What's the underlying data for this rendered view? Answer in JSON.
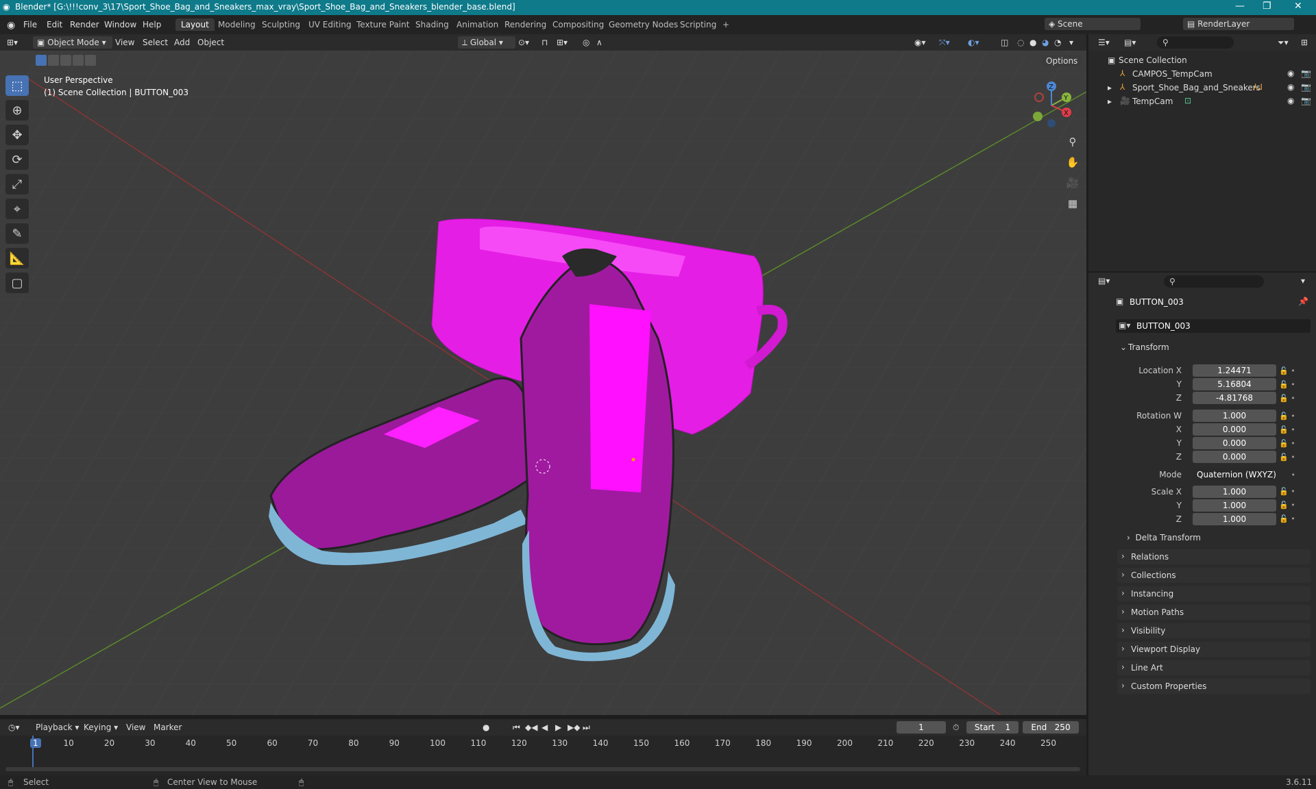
{
  "title_bar": {
    "title": "Blender* [G:\\!!!conv_3\\17\\Sport_Shoe_Bag_and_Sneakers_max_vray\\Sport_Shoe_Bag_and_Sneakers_blender_base.blend]",
    "minimize": "—",
    "maximize": "❐",
    "close": "✕"
  },
  "menu": [
    "File",
    "Edit",
    "Render",
    "Window",
    "Help"
  ],
  "workspaces": [
    "Layout",
    "Modeling",
    "Sculpting",
    "UV Editing",
    "Texture Paint",
    "Shading",
    "Animation",
    "Rendering",
    "Compositing",
    "Geometry Nodes",
    "Scripting",
    "+"
  ],
  "scene": "Scene",
  "render_layer": "RenderLayer",
  "viewport_header": {
    "mode": "Object Mode",
    "view": "View",
    "select": "Select",
    "add": "Add",
    "object": "Object",
    "orientation": "Global",
    "options": "Options"
  },
  "viewport_overlay": {
    "perspective": "User Perspective",
    "collection": "(1) Scene Collection | BUTTON_003"
  },
  "gizmo": {
    "x": "X",
    "y": "Y",
    "z": "Z"
  },
  "outliner": {
    "root": "Scene Collection",
    "items": [
      {
        "name": "CAMPOS_TempCam"
      },
      {
        "name": "Sport_Shoe_Bag_and_Sneakers"
      },
      {
        "name": "TempCam"
      }
    ]
  },
  "properties": {
    "object_name": "BUTTON_003",
    "data_name": "BUTTON_003",
    "transform_label": "Transform",
    "location_label": "Location X",
    "location": [
      "1.24471",
      "5.16804",
      "-4.81768"
    ],
    "rotation_label": "Rotation W",
    "rotation": [
      "1.000",
      "0.000",
      "0.000",
      "0.000"
    ],
    "mode_label": "Mode",
    "mode_value": "Quaternion (WXYZ)",
    "scale_label": "Scale X",
    "scale": [
      "1.000",
      "1.000",
      "1.000"
    ],
    "axis_labels": [
      "X",
      "Y",
      "Z"
    ],
    "delta": "Delta Transform",
    "sections": [
      "Relations",
      "Collections",
      "Instancing",
      "Motion Paths",
      "Visibility",
      "Viewport Display",
      "Line Art",
      "Custom Properties"
    ]
  },
  "timeline": {
    "playback": "Playback",
    "keying": "Keying",
    "view": "View",
    "marker": "Marker",
    "current_frame": "1",
    "start_label": "Start",
    "start": "1",
    "end_label": "End",
    "end": "250",
    "ticks": [
      "1",
      "10",
      "20",
      "30",
      "40",
      "50",
      "60",
      "70",
      "80",
      "90",
      "100",
      "110",
      "120",
      "130",
      "140",
      "150",
      "160",
      "170",
      "180",
      "190",
      "200",
      "210",
      "220",
      "230",
      "240",
      "250"
    ]
  },
  "status": {
    "select": "Select",
    "center": "Center View to Mouse",
    "version": "3.6.11"
  },
  "colors": {
    "accent": "#4772b3",
    "titlebar": "#0e7a8a",
    "magenta": "#ff00ff",
    "sole": "#7fb6d6"
  }
}
